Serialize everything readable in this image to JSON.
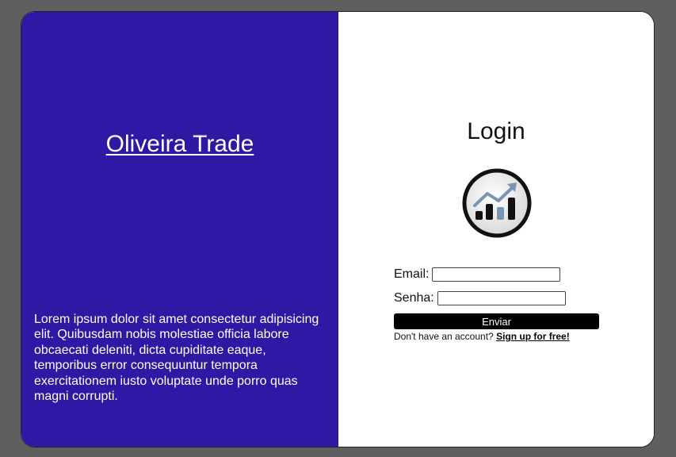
{
  "brand": {
    "name": "Oliveira Trade",
    "description": "Lorem ipsum dolor sit amet consectetur adipisicing elit. Quibusdam nobis molestiae officia labore obcaecati deleniti, dicta cupiditate eaque, temporibus error consequuntur tempora exercitationem iusto voluptate unde porro quas magni corrupti."
  },
  "login": {
    "title": "Login",
    "logo_icon": "trading-chart-icon",
    "email_label": "Email:",
    "email_value": "",
    "senha_label": "Senha:",
    "senha_value": "",
    "submit_label": "Enviar",
    "signup_prompt": "Don't have an account?",
    "signup_link": "Sign up for free!"
  },
  "colors": {
    "left_panel": "#2d19a3",
    "page_background": "#5f5f5f",
    "button": "#000000",
    "logo_bars": "#111111",
    "logo_accent": "#7a95b0"
  }
}
